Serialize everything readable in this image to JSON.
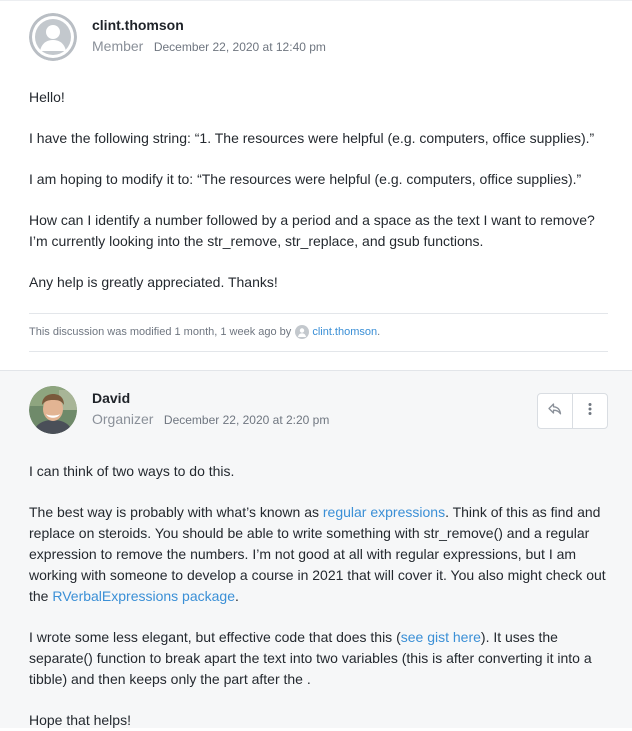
{
  "post1": {
    "username": "clint.thomson",
    "role": "Member",
    "date": "December 22, 2020 at 12:40 pm",
    "paragraphs": [
      "Hello!",
      "I have the following string: “1. The resources were helpful (e.g. computers, office supplies).”",
      "I am hoping to modify it to: “The resources were helpful (e.g. computers, office supplies).”",
      "How can I identify a number followed by a period and a space as the text I want to remove? I’m currently looking into the str_remove, str_replace, and gsub functions.",
      "Any help is greatly appreciated. Thanks!"
    ],
    "modified_text": "This discussion was modified 1 month, 1 week ago by",
    "modified_by": "clint.thomson",
    "modified_end": "."
  },
  "post2": {
    "username": "David",
    "role": "Organizer",
    "date": "December 22, 2020 at 2:20 pm",
    "p1": "I can think of two ways to do this.",
    "p2_a": "The best way is probably with what’s known as ",
    "p2_link1": "regular expressions",
    "p2_b": ". Think of this as find and replace on steroids. You should be able to write something with str_remove() and a regular expression to remove the numbers. I’m not good at all with regular expressions, but I am working with someone to develop a course in 2021 that will cover it. You also might check out the ",
    "p2_link2": "RVerbalExpressions package",
    "p2_c": ".",
    "p3_a": "I wrote some less elegant, but effective code that does this (",
    "p3_link": "see gist here",
    "p3_b": "). It uses the separate() function to break apart the text into two variables (this is after converting it into a tibble) and then keeps only the part after the .",
    "p4": "Hope that helps!"
  },
  "icons": {
    "reply": "reply-icon",
    "more": "more-vertical-icon",
    "default_avatar": "default-avatar-icon"
  },
  "colors": {
    "link": "#3a8fd6",
    "muted": "#8a9099",
    "reply_bg": "#f6f7f8"
  }
}
